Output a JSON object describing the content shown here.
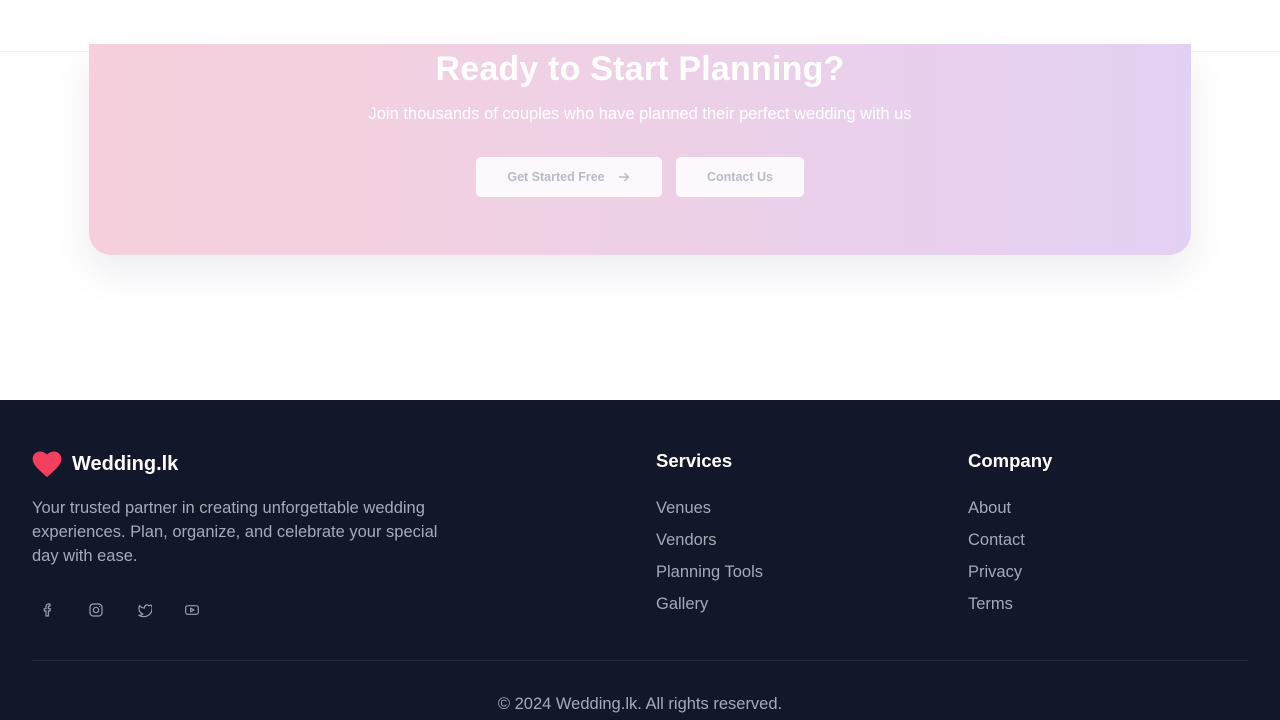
{
  "cta": {
    "title": "Ready to Start Planning?",
    "subtitle": "Join thousands of couples who have planned their perfect wedding with us",
    "primary_button": "Get Started Free",
    "secondary_button": "Contact Us"
  },
  "footer": {
    "brand": {
      "name": "Wedding.lk",
      "description": "Your trusted partner in creating unforgettable wedding experiences. Plan, organize, and celebrate your special day with ease."
    },
    "socials": [
      "facebook-icon",
      "instagram-icon",
      "twitter-icon",
      "youtube-icon"
    ],
    "services": {
      "heading": "Services",
      "links": [
        "Venues",
        "Vendors",
        "Planning Tools",
        "Gallery"
      ]
    },
    "company": {
      "heading": "Company",
      "links": [
        "About",
        "Contact",
        "Privacy",
        "Terms"
      ]
    },
    "copyright": "© 2024 Wedding.lk. All rights reserved."
  },
  "colors": {
    "footer_bg": "#121829",
    "heart": "#f43f5e",
    "cta_gradient_start": "#f5d0dc",
    "cta_gradient_end": "#e3d1f4"
  }
}
